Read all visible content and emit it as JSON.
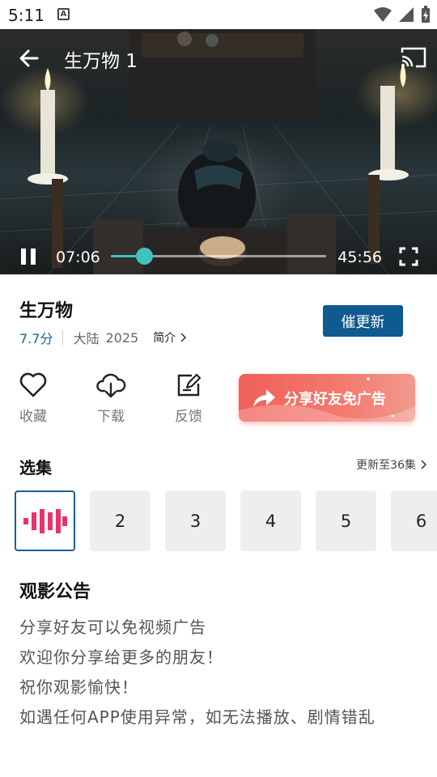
{
  "status_bar": {
    "time": "5:11",
    "notification_icon": "A"
  },
  "player": {
    "title": "生万物 1",
    "current_time": "07:06",
    "total_time": "45:56",
    "progress_fraction": 0.155,
    "accent_color": "#3fc2c0",
    "icons": [
      "back-arrow-icon",
      "cast-icon",
      "pause-icon",
      "fullscreen-icon"
    ]
  },
  "show": {
    "title": "生万物",
    "rating": "7.7分",
    "region": "大陆",
    "year": "2025",
    "intro_label": "简介",
    "urge_button": "催更新",
    "brand_color": "#0f5a8f"
  },
  "actions": [
    {
      "label": "收藏",
      "icon": "heart-icon"
    },
    {
      "label": "下载",
      "icon": "cloud-download-icon"
    },
    {
      "label": "反馈",
      "icon": "edit-icon"
    }
  ],
  "share_banner": {
    "label": "分享好友免广告",
    "icon": "share-arrow-icon",
    "color": "#f0605a"
  },
  "episodes": {
    "title": "选集",
    "update_status": "更新至36集",
    "items": [
      "2",
      "3",
      "4",
      "5",
      "6"
    ],
    "active_icon": "playing-bars-icon"
  },
  "notice": {
    "title": "观影公告",
    "lines": [
      "分享好友可以免视频广告",
      "欢迎你分享给更多的朋友！",
      "祝你观影愉快！",
      "如遇任何APP使用异常，如无法播放、剧情错乱"
    ]
  }
}
